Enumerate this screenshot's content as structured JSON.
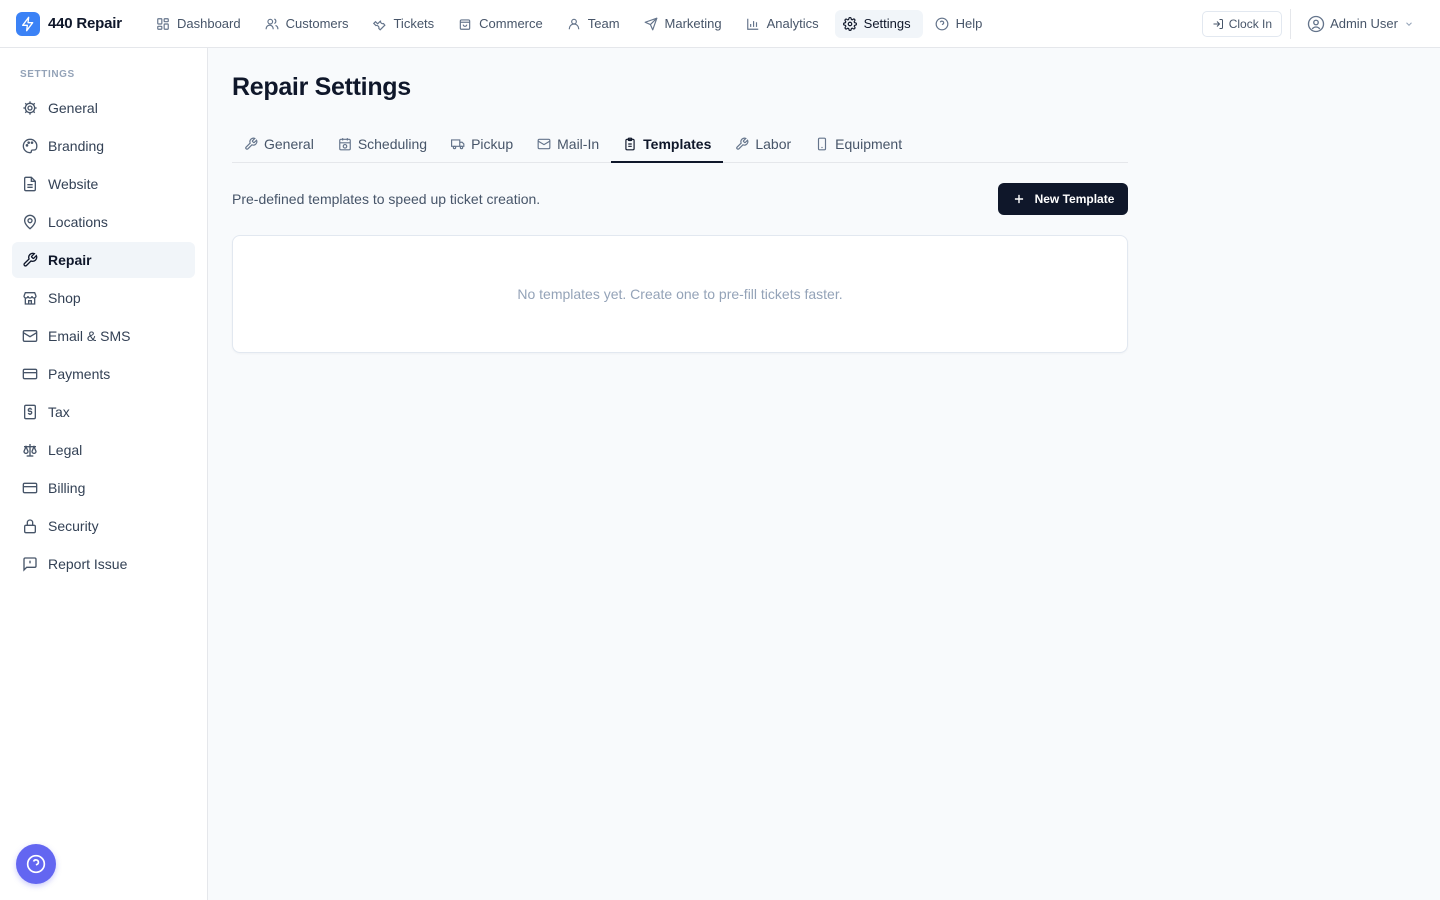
{
  "app": {
    "name": "440 Repair",
    "brand_color": "#3b82f6"
  },
  "topnav": {
    "items": [
      {
        "label": "Dashboard",
        "icon": "dashboard-icon"
      },
      {
        "label": "Customers",
        "icon": "users-icon"
      },
      {
        "label": "Tickets",
        "icon": "wrench-icon"
      },
      {
        "label": "Commerce",
        "icon": "bag-icon"
      },
      {
        "label": "Team",
        "icon": "user-icon"
      },
      {
        "label": "Marketing",
        "icon": "send-icon"
      },
      {
        "label": "Analytics",
        "icon": "bar-chart-icon"
      },
      {
        "label": "Settings",
        "icon": "gear-icon",
        "active": true
      },
      {
        "label": "Help",
        "icon": "help-circle-icon"
      }
    ],
    "clock_in_label": "Clock In",
    "user_name": "Admin User"
  },
  "sidebar": {
    "heading": "SETTINGS",
    "items": [
      {
        "label": "General",
        "icon": "gear-icon"
      },
      {
        "label": "Branding",
        "icon": "palette-icon"
      },
      {
        "label": "Website",
        "icon": "file-icon"
      },
      {
        "label": "Locations",
        "icon": "map-pin-icon"
      },
      {
        "label": "Repair",
        "icon": "wrench-icon",
        "active": true
      },
      {
        "label": "Shop",
        "icon": "store-icon"
      },
      {
        "label": "Email & SMS",
        "icon": "mail-icon"
      },
      {
        "label": "Payments",
        "icon": "credit-card-icon"
      },
      {
        "label": "Tax",
        "icon": "receipt-icon"
      },
      {
        "label": "Legal",
        "icon": "scale-icon"
      },
      {
        "label": "Billing",
        "icon": "credit-card-icon"
      },
      {
        "label": "Security",
        "icon": "lock-icon"
      },
      {
        "label": "Report Issue",
        "icon": "alert-message-icon"
      }
    ]
  },
  "main": {
    "title": "Repair Settings",
    "tabs": [
      {
        "label": "General",
        "icon": "wrench-icon"
      },
      {
        "label": "Scheduling",
        "icon": "calendar-clock-icon"
      },
      {
        "label": "Pickup",
        "icon": "truck-icon"
      },
      {
        "label": "Mail-In",
        "icon": "mail-icon"
      },
      {
        "label": "Templates",
        "icon": "clipboard-icon",
        "active": true
      },
      {
        "label": "Labor",
        "icon": "wrench-icon"
      },
      {
        "label": "Equipment",
        "icon": "smartphone-icon"
      }
    ],
    "description": "Pre-defined templates to speed up ticket creation.",
    "new_button_label": "New Template",
    "empty_message": "No templates yet. Create one to pre-fill tickets faster."
  },
  "colors": {
    "primary_dark": "#0f172a",
    "help_fab": "#6366f1"
  }
}
